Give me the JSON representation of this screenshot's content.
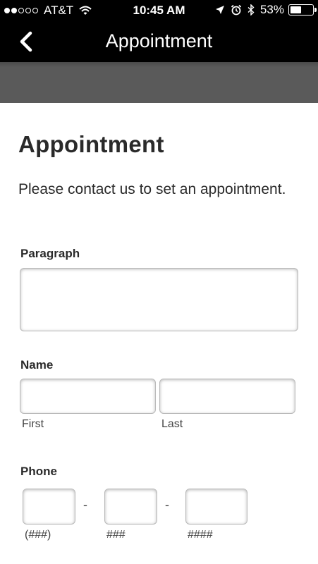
{
  "status_bar": {
    "carrier": "AT&T",
    "time": "10:45 AM",
    "battery_percent": "53%",
    "battery_level": 0.53,
    "signal_bars_filled": 2,
    "signal_bars_total": 5,
    "icons": [
      "wifi-icon",
      "location-arrow-icon",
      "alarm-clock-icon",
      "bluetooth-icon",
      "battery-icon"
    ]
  },
  "nav": {
    "title": "Appointment",
    "back_icon": "chevron-left-icon"
  },
  "page": {
    "title": "Appointment",
    "intro": "Please contact us to set an appointment."
  },
  "form": {
    "paragraph": {
      "label": "Paragraph",
      "value": ""
    },
    "name": {
      "label": "Name",
      "first_label": "First",
      "last_label": "Last",
      "first_value": "",
      "last_value": ""
    },
    "phone": {
      "label": "Phone",
      "area_label": "(###)",
      "prefix_label": "###",
      "line_label": "####",
      "separator": "-"
    }
  },
  "colors": {
    "nav_background": "#000000",
    "banner_gray": "#5a5a5a",
    "text": "#2a2a2a"
  }
}
